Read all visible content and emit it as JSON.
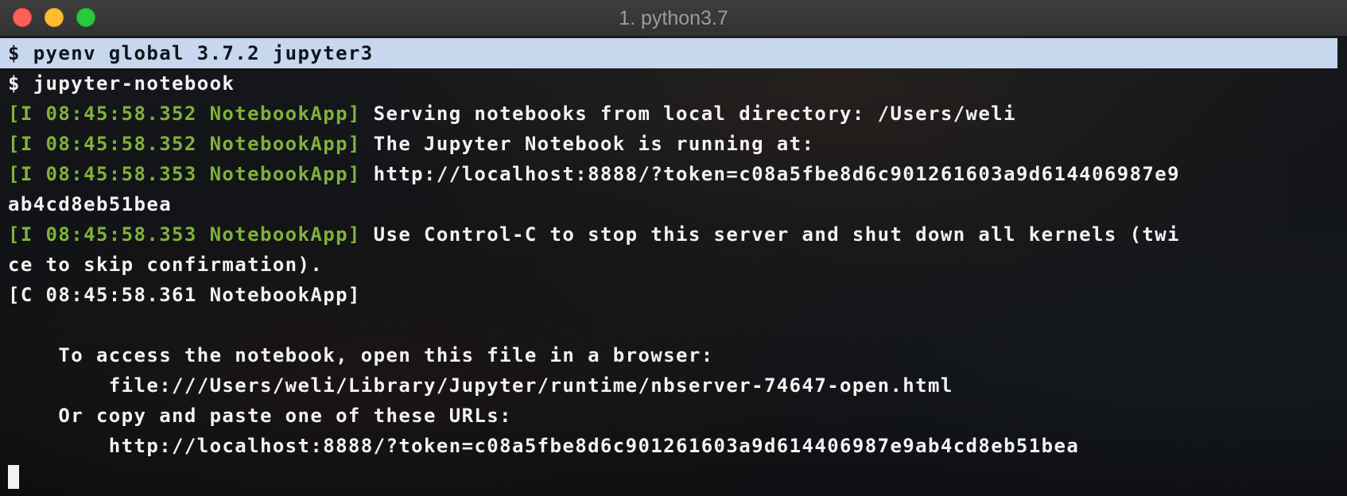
{
  "window": {
    "title": "1. python3.7",
    "controls": {
      "close_icon": "close-icon",
      "minimize_icon": "minimize-icon",
      "zoom_icon": "zoom-icon"
    }
  },
  "terminal": {
    "lines": [
      {
        "text": "$ pyenv global 3.7.2 jupyter3",
        "selected": true
      },
      {
        "text": "$ jupyter-notebook"
      },
      {
        "tag": "[I 08:45:58.352 NotebookApp]",
        "text": " Serving notebooks from local directory: /Users/weli"
      },
      {
        "tag": "[I 08:45:58.352 NotebookApp]",
        "text": " The Jupyter Notebook is running at:"
      },
      {
        "tag": "[I 08:45:58.353 NotebookApp]",
        "text": " http://localhost:8888/?token=c08a5fbe8d6c901261603a9d614406987e9"
      },
      {
        "text": "ab4cd8eb51bea"
      },
      {
        "tag": "[I 08:45:58.353 NotebookApp]",
        "text": " Use Control-C to stop this server and shut down all kernels (twi"
      },
      {
        "text": "ce to skip confirmation)."
      },
      {
        "text": "[C 08:45:58.361 NotebookApp]"
      },
      {
        "text": ""
      },
      {
        "text": "    To access the notebook, open this file in a browser:"
      },
      {
        "text": "        file:///Users/weli/Library/Jupyter/runtime/nbserver-74647-open.html"
      },
      {
        "text": "    Or copy and paste one of these URLs:"
      },
      {
        "text": "        http://localhost:8888/?token=c08a5fbe8d6c901261603a9d614406987e9ab4cd8eb51bea"
      }
    ]
  },
  "colors": {
    "log_tag": "#7fb23a",
    "text": "#f2f2f2",
    "selection": "#c6d7ee",
    "close": "#fe5f57",
    "minimize": "#febc2e",
    "zoom": "#28c840"
  }
}
